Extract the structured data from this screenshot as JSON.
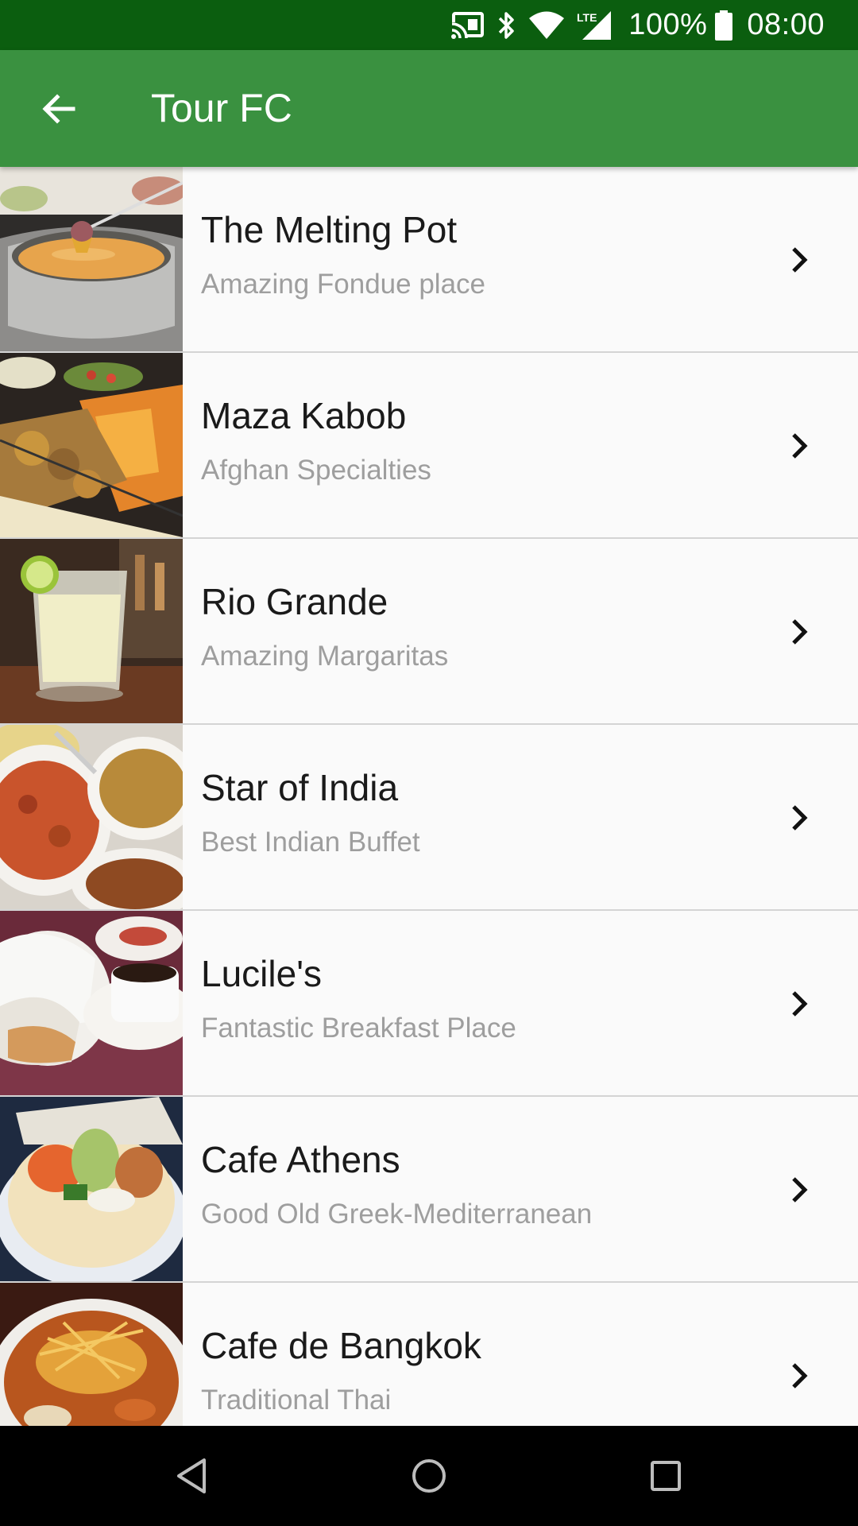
{
  "status_bar": {
    "battery": "100%",
    "time": "08:00",
    "network": "LTE",
    "icons": [
      "cast-icon",
      "bluetooth-icon",
      "wifi-icon",
      "lte-signal-icon",
      "battery-icon"
    ]
  },
  "app_bar": {
    "title": "Tour FC",
    "back_icon": "arrow-back-icon",
    "color": "#3a9140",
    "status_color": "#0b5e0f"
  },
  "restaurants": [
    {
      "name": "The Melting Pot",
      "subtitle": "Amazing Fondue place",
      "image": "fondue-photo"
    },
    {
      "name": "Maza Kabob",
      "subtitle": "Afghan Specialties",
      "image": "kabob-photo"
    },
    {
      "name": "Rio Grande",
      "subtitle": "Amazing Margaritas",
      "image": "margarita-photo"
    },
    {
      "name": "Star of India",
      "subtitle": "Best Indian Buffet",
      "image": "curry-photo"
    },
    {
      "name": "Lucile's",
      "subtitle": "Fantastic Breakfast Place",
      "image": "beignet-photo"
    },
    {
      "name": "Cafe Athens",
      "subtitle": "Good Old Greek-Mediterranean",
      "image": "gyro-photo"
    },
    {
      "name": "Cafe de Bangkok",
      "subtitle": "Traditional Thai",
      "image": "thai-noodle-photo"
    }
  ],
  "nav_bar": {
    "icons": [
      "back-triangle-icon",
      "home-circle-icon",
      "recents-square-icon"
    ]
  }
}
